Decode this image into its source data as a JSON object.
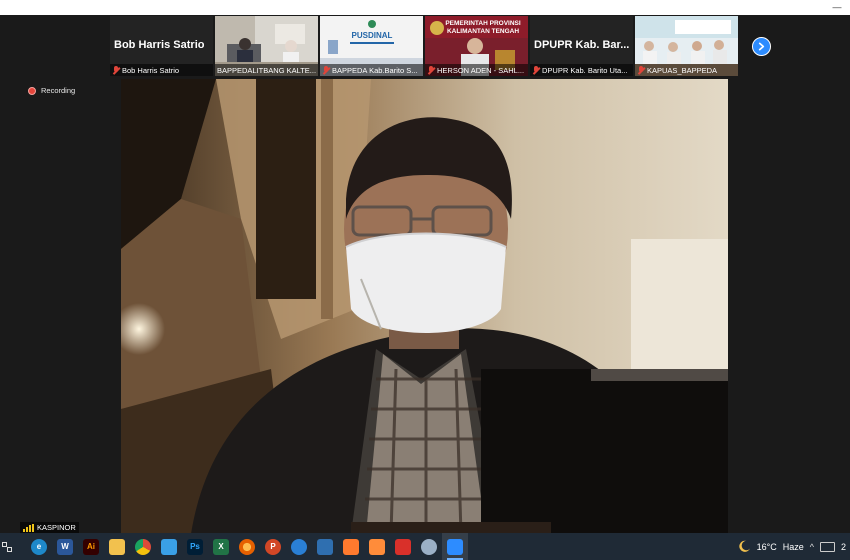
{
  "window": {
    "minimize_symbol": "—"
  },
  "filmstrip": {
    "tiles": [
      {
        "display_name": "Bob Harris Satrio",
        "caption": "Bob Harris Satrio",
        "muted": true,
        "type": "name-only"
      },
      {
        "caption": "BAPPEDALITBANG KALTE...",
        "muted": false,
        "type": "video"
      },
      {
        "caption": "BAPPEDA Kab.Barito S...",
        "muted": true,
        "type": "video",
        "sign_text": "PUSDINAL"
      },
      {
        "caption": "HERSON ADEN - SAHL...",
        "muted": true,
        "type": "video",
        "banner_line1": "PEMERINTAH PROVINSI",
        "banner_line2": "KALIMANTAN TENGAH"
      },
      {
        "display_name": "DPUPR Kab. Bar...",
        "caption": "DPUPR Kab. Barito Uta...",
        "muted": true,
        "type": "name-only"
      },
      {
        "caption": "KAPUAS_BAPPEDA",
        "muted": true,
        "type": "video"
      }
    ],
    "next_icon": "chevron-right-icon"
  },
  "recording": {
    "label": "Recording",
    "color": "#e5453b"
  },
  "active_speaker": {
    "name": "KASPINOR"
  },
  "taskbar": {
    "apps": [
      {
        "name": "edge-icon",
        "color": "#1e88c9",
        "glyph": "e"
      },
      {
        "name": "word-icon",
        "color": "#2b579a",
        "glyph": "W"
      },
      {
        "name": "illustrator-icon",
        "color": "#330000",
        "glyph": "Ai"
      },
      {
        "name": "file-explorer-icon",
        "color": "#f2c14e",
        "glyph": ""
      },
      {
        "name": "chrome-icon",
        "color": "#dd4b39",
        "glyph": ""
      },
      {
        "name": "mail-icon",
        "color": "#3aa0e6",
        "glyph": ""
      },
      {
        "name": "photoshop-icon",
        "color": "#001e36",
        "glyph": "Ps"
      },
      {
        "name": "excel-icon",
        "color": "#217346",
        "glyph": "X"
      },
      {
        "name": "firefox-icon",
        "color": "#e66000",
        "glyph": ""
      },
      {
        "name": "powerpoint-icon",
        "color": "#d24726",
        "glyph": "P"
      },
      {
        "name": "app-icon",
        "color": "#2a7fd4",
        "glyph": ""
      },
      {
        "name": "app2-icon",
        "color": "#2f6fb0",
        "glyph": ""
      },
      {
        "name": "app3-icon",
        "color": "#ff7a2e",
        "glyph": ""
      },
      {
        "name": "app4-icon",
        "color": "#ff8c3a",
        "glyph": ""
      },
      {
        "name": "acrobat-icon",
        "color": "#d9302a",
        "glyph": ""
      },
      {
        "name": "app5-icon",
        "color": "#9bb0c6",
        "glyph": ""
      },
      {
        "name": "zoom-icon",
        "color": "#2d8cff",
        "glyph": "",
        "active": true
      }
    ],
    "weather": {
      "temperature": "16°C",
      "condition": "Haze"
    },
    "clock_fragment": "2"
  }
}
